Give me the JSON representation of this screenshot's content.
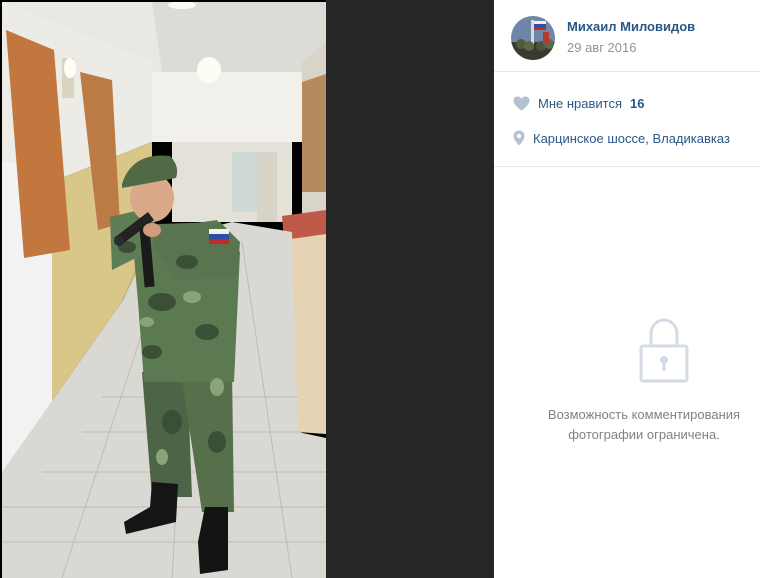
{
  "post": {
    "author_name": "Михаил Миловидов",
    "date": "29 авг 2016"
  },
  "likes": {
    "label": "Мне нравится",
    "count": "16"
  },
  "location": {
    "text": "Карцинское шоссе, Владикавказ"
  },
  "comments": {
    "restricted_line1": "Возможность комментирования",
    "restricted_line2": "фотографии ограничена."
  },
  "icons": {
    "like": "heart-icon",
    "location": "map-pin-icon",
    "restricted": "lock-icon"
  },
  "colors": {
    "link": "#2a5885",
    "muted": "#939393",
    "icon": "#b4c1d1"
  }
}
